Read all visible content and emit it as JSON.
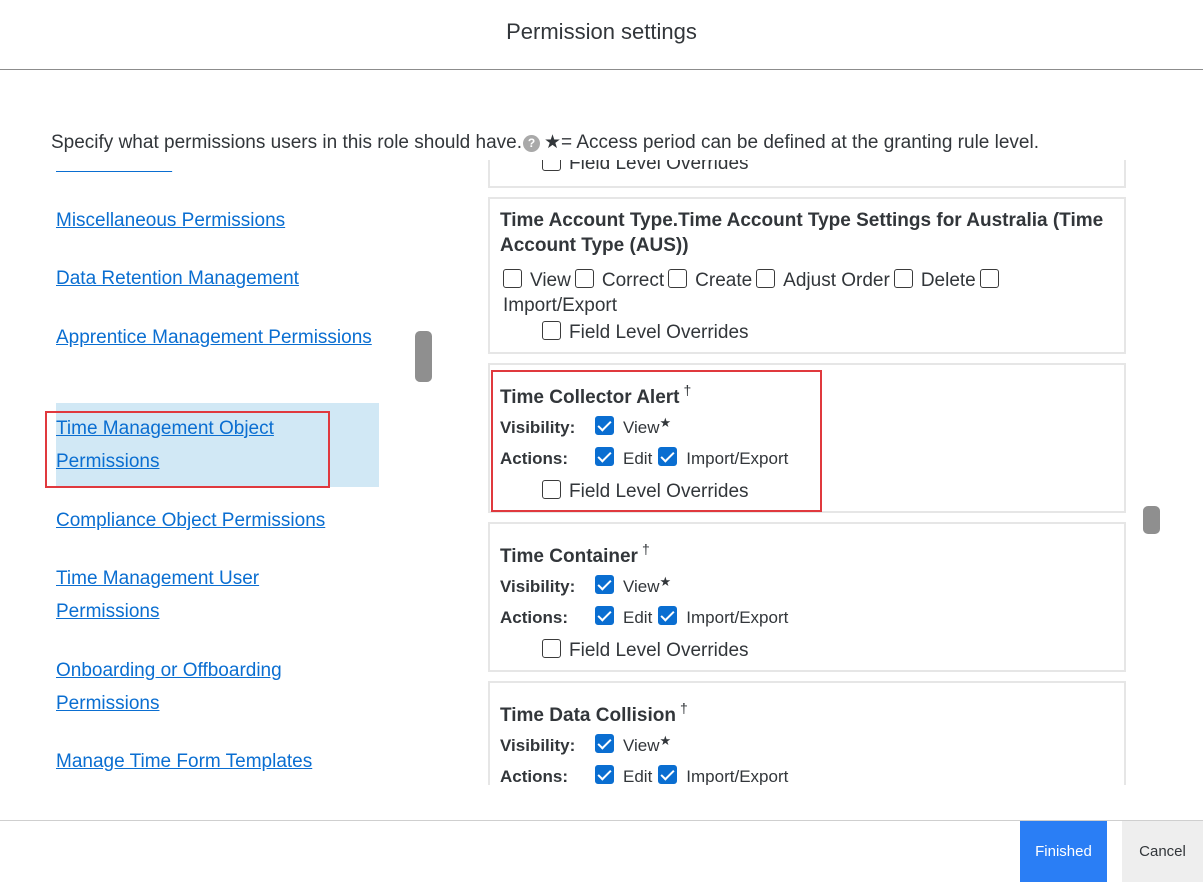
{
  "dialog": {
    "title": "Permission settings"
  },
  "intro": {
    "text": "Specify what permissions users in this role should have.",
    "help_icon": "?",
    "legend": "★= Access period can be defined at the granting rule level."
  },
  "nav": {
    "items": [
      {
        "label": "Miscellaneous Permissions"
      },
      {
        "label": "Data Retention Management"
      },
      {
        "label": "Apprentice Management Permissions"
      },
      {
        "label": "Time Management Object Permissions",
        "selected": true
      },
      {
        "label": "Compliance Object Permissions"
      },
      {
        "label": "Time Management User Permissions"
      },
      {
        "label": "Onboarding or Offboarding Permissions"
      },
      {
        "label": "Manage Time Form Templates"
      }
    ]
  },
  "cards": {
    "prev": {
      "field_level": "Field Level Overrides"
    },
    "time_account_type": {
      "title": "Time Account Type.Time Account Type Settings for Australia (Time Account Type (AUS))",
      "options": [
        "View",
        "Correct",
        "Create",
        "Adjust Order",
        "Delete",
        "Import/Export"
      ],
      "field_level": "Field Level Overrides"
    },
    "time_collector_alert": {
      "title": "Time Collector Alert",
      "dagger": "†",
      "visibility_label": "Visibility:",
      "view": "View",
      "star": "★",
      "actions_label": "Actions:",
      "edit": "Edit",
      "import_export": "Import/Export",
      "field_level": "Field Level Overrides"
    },
    "time_container": {
      "title": "Time Container",
      "dagger": "†",
      "visibility_label": "Visibility:",
      "view": "View",
      "star": "★",
      "actions_label": "Actions:",
      "edit": "Edit",
      "import_export": "Import/Export",
      "field_level": "Field Level Overrides"
    },
    "time_data_collision": {
      "title": "Time Data Collision",
      "dagger": "†",
      "visibility_label": "Visibility:",
      "view": "View",
      "star": "★",
      "actions_label": "Actions:",
      "edit": "Edit",
      "import_export": "Import/Export"
    }
  },
  "footer": {
    "finished": "Finished",
    "cancel": "Cancel"
  },
  "colors": {
    "accent": "#0a6ed1",
    "primary_button": "#2a7ef5",
    "highlight_box": "#e0393e",
    "selected_bg": "#d1e8f5"
  }
}
